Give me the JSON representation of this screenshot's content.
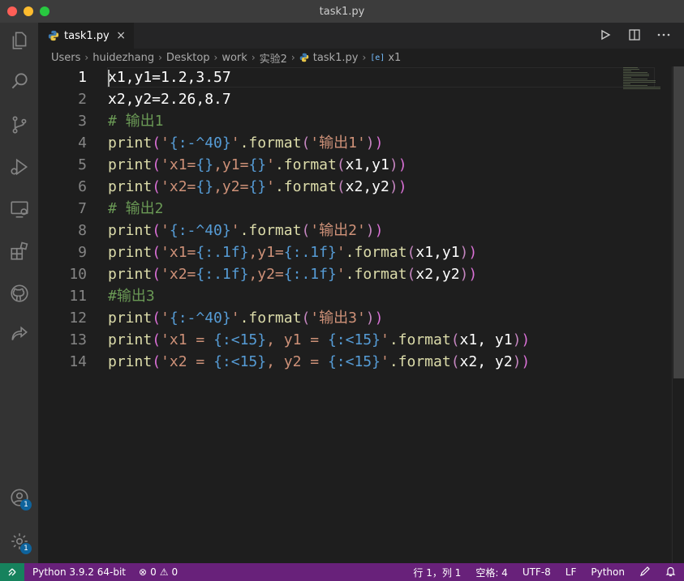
{
  "window": {
    "title": "task1.py"
  },
  "tab": {
    "label": "task1.py",
    "close": "×"
  },
  "breadcrumb": [
    "Users",
    "huidezhang",
    "Desktop",
    "work",
    "实验2",
    "task1.py",
    "x1"
  ],
  "code": [
    {
      "n": "1",
      "tokens": [
        {
          "t": "x1,y1=1.2,3.57",
          "c": "#ffffff"
        }
      ]
    },
    {
      "n": "2",
      "tokens": [
        {
          "t": "x2,y2=2.26,8.7",
          "c": "#ffffff"
        }
      ]
    },
    {
      "n": "3",
      "tokens": [
        {
          "t": "# 输出1",
          "c": "#6a9955"
        }
      ]
    },
    {
      "n": "4",
      "tokens": [
        {
          "t": "print",
          "c": "#dcdcaa"
        },
        {
          "t": "(",
          "c": "#da70d6"
        },
        {
          "t": "'",
          "c": "#ce9178"
        },
        {
          "t": "{:-^40}",
          "c": "#569cd6"
        },
        {
          "t": "'",
          "c": "#ce9178"
        },
        {
          "t": ".format",
          "c": "#dcdcaa"
        },
        {
          "t": "(",
          "c": "#c586c0"
        },
        {
          "t": "'输出1'",
          "c": "#ce9178"
        },
        {
          "t": ")",
          "c": "#c586c0"
        },
        {
          "t": ")",
          "c": "#da70d6"
        }
      ]
    },
    {
      "n": "5",
      "tokens": [
        {
          "t": "print",
          "c": "#dcdcaa"
        },
        {
          "t": "(",
          "c": "#da70d6"
        },
        {
          "t": "'x1=",
          "c": "#ce9178"
        },
        {
          "t": "{}",
          "c": "#569cd6"
        },
        {
          "t": ",y1=",
          "c": "#ce9178"
        },
        {
          "t": "{}",
          "c": "#569cd6"
        },
        {
          "t": "'",
          "c": "#ce9178"
        },
        {
          "t": ".format",
          "c": "#dcdcaa"
        },
        {
          "t": "(",
          "c": "#c586c0"
        },
        {
          "t": "x1,y1",
          "c": "#ffffff"
        },
        {
          "t": ")",
          "c": "#c586c0"
        },
        {
          "t": ")",
          "c": "#da70d6"
        }
      ]
    },
    {
      "n": "6",
      "tokens": [
        {
          "t": "print",
          "c": "#dcdcaa"
        },
        {
          "t": "(",
          "c": "#da70d6"
        },
        {
          "t": "'x2=",
          "c": "#ce9178"
        },
        {
          "t": "{}",
          "c": "#569cd6"
        },
        {
          "t": ",y2=",
          "c": "#ce9178"
        },
        {
          "t": "{}",
          "c": "#569cd6"
        },
        {
          "t": "'",
          "c": "#ce9178"
        },
        {
          "t": ".format",
          "c": "#dcdcaa"
        },
        {
          "t": "(",
          "c": "#c586c0"
        },
        {
          "t": "x2,y2",
          "c": "#ffffff"
        },
        {
          "t": ")",
          "c": "#c586c0"
        },
        {
          "t": ")",
          "c": "#da70d6"
        }
      ]
    },
    {
      "n": "7",
      "tokens": [
        {
          "t": "# 输出2",
          "c": "#6a9955"
        }
      ]
    },
    {
      "n": "8",
      "tokens": [
        {
          "t": "print",
          "c": "#dcdcaa"
        },
        {
          "t": "(",
          "c": "#da70d6"
        },
        {
          "t": "'",
          "c": "#ce9178"
        },
        {
          "t": "{:-^40}",
          "c": "#569cd6"
        },
        {
          "t": "'",
          "c": "#ce9178"
        },
        {
          "t": ".format",
          "c": "#dcdcaa"
        },
        {
          "t": "(",
          "c": "#c586c0"
        },
        {
          "t": "'输出2'",
          "c": "#ce9178"
        },
        {
          "t": ")",
          "c": "#c586c0"
        },
        {
          "t": ")",
          "c": "#da70d6"
        }
      ]
    },
    {
      "n": "9",
      "tokens": [
        {
          "t": "print",
          "c": "#dcdcaa"
        },
        {
          "t": "(",
          "c": "#da70d6"
        },
        {
          "t": "'x1=",
          "c": "#ce9178"
        },
        {
          "t": "{:.1f}",
          "c": "#569cd6"
        },
        {
          "t": ",y1=",
          "c": "#ce9178"
        },
        {
          "t": "{:.1f}",
          "c": "#569cd6"
        },
        {
          "t": "'",
          "c": "#ce9178"
        },
        {
          "t": ".format",
          "c": "#dcdcaa"
        },
        {
          "t": "(",
          "c": "#c586c0"
        },
        {
          "t": "x1,y1",
          "c": "#ffffff"
        },
        {
          "t": ")",
          "c": "#c586c0"
        },
        {
          "t": ")",
          "c": "#da70d6"
        }
      ]
    },
    {
      "n": "10",
      "tokens": [
        {
          "t": "print",
          "c": "#dcdcaa"
        },
        {
          "t": "(",
          "c": "#da70d6"
        },
        {
          "t": "'x2=",
          "c": "#ce9178"
        },
        {
          "t": "{:.1f}",
          "c": "#569cd6"
        },
        {
          "t": ",y2=",
          "c": "#ce9178"
        },
        {
          "t": "{:.1f}",
          "c": "#569cd6"
        },
        {
          "t": "'",
          "c": "#ce9178"
        },
        {
          "t": ".format",
          "c": "#dcdcaa"
        },
        {
          "t": "(",
          "c": "#c586c0"
        },
        {
          "t": "x2,y2",
          "c": "#ffffff"
        },
        {
          "t": ")",
          "c": "#c586c0"
        },
        {
          "t": ")",
          "c": "#da70d6"
        }
      ]
    },
    {
      "n": "11",
      "tokens": [
        {
          "t": "#输出3",
          "c": "#6a9955"
        }
      ]
    },
    {
      "n": "12",
      "tokens": [
        {
          "t": "print",
          "c": "#dcdcaa"
        },
        {
          "t": "(",
          "c": "#da70d6"
        },
        {
          "t": "'",
          "c": "#ce9178"
        },
        {
          "t": "{:-^40}",
          "c": "#569cd6"
        },
        {
          "t": "'",
          "c": "#ce9178"
        },
        {
          "t": ".format",
          "c": "#dcdcaa"
        },
        {
          "t": "(",
          "c": "#c586c0"
        },
        {
          "t": "'输出3'",
          "c": "#ce9178"
        },
        {
          "t": ")",
          "c": "#c586c0"
        },
        {
          "t": ")",
          "c": "#da70d6"
        }
      ]
    },
    {
      "n": "13",
      "tokens": [
        {
          "t": "print",
          "c": "#dcdcaa"
        },
        {
          "t": "(",
          "c": "#da70d6"
        },
        {
          "t": "'x1 = ",
          "c": "#ce9178"
        },
        {
          "t": "{:<15}",
          "c": "#569cd6"
        },
        {
          "t": ", y1 = ",
          "c": "#ce9178"
        },
        {
          "t": "{:<15}",
          "c": "#569cd6"
        },
        {
          "t": "'",
          "c": "#ce9178"
        },
        {
          "t": ".format",
          "c": "#dcdcaa"
        },
        {
          "t": "(",
          "c": "#c586c0"
        },
        {
          "t": "x1, y1",
          "c": "#ffffff"
        },
        {
          "t": ")",
          "c": "#c586c0"
        },
        {
          "t": ")",
          "c": "#da70d6"
        }
      ]
    },
    {
      "n": "14",
      "tokens": [
        {
          "t": "print",
          "c": "#dcdcaa"
        },
        {
          "t": "(",
          "c": "#da70d6"
        },
        {
          "t": "'x2 = ",
          "c": "#ce9178"
        },
        {
          "t": "{:<15}",
          "c": "#569cd6"
        },
        {
          "t": ", y2 = ",
          "c": "#ce9178"
        },
        {
          "t": "{:<15}",
          "c": "#569cd6"
        },
        {
          "t": "'",
          "c": "#ce9178"
        },
        {
          "t": ".format",
          "c": "#dcdcaa"
        },
        {
          "t": "(",
          "c": "#c586c0"
        },
        {
          "t": "x2, y2",
          "c": "#ffffff"
        },
        {
          "t": ")",
          "c": "#c586c0"
        },
        {
          "t": ")",
          "c": "#da70d6"
        }
      ]
    }
  ],
  "activity_badges": {
    "accounts": "1",
    "settings": "1"
  },
  "status": {
    "python": "Python 3.9.2 64-bit",
    "errors": "0",
    "warnings": "0",
    "position": "行 1，列 1",
    "spaces": "空格: 4",
    "encoding": "UTF-8",
    "eol": "LF",
    "language": "Python"
  },
  "colors": {
    "statusbar": "#68217a",
    "remote": "#16825d",
    "editor_bg": "#1e1e1e"
  }
}
